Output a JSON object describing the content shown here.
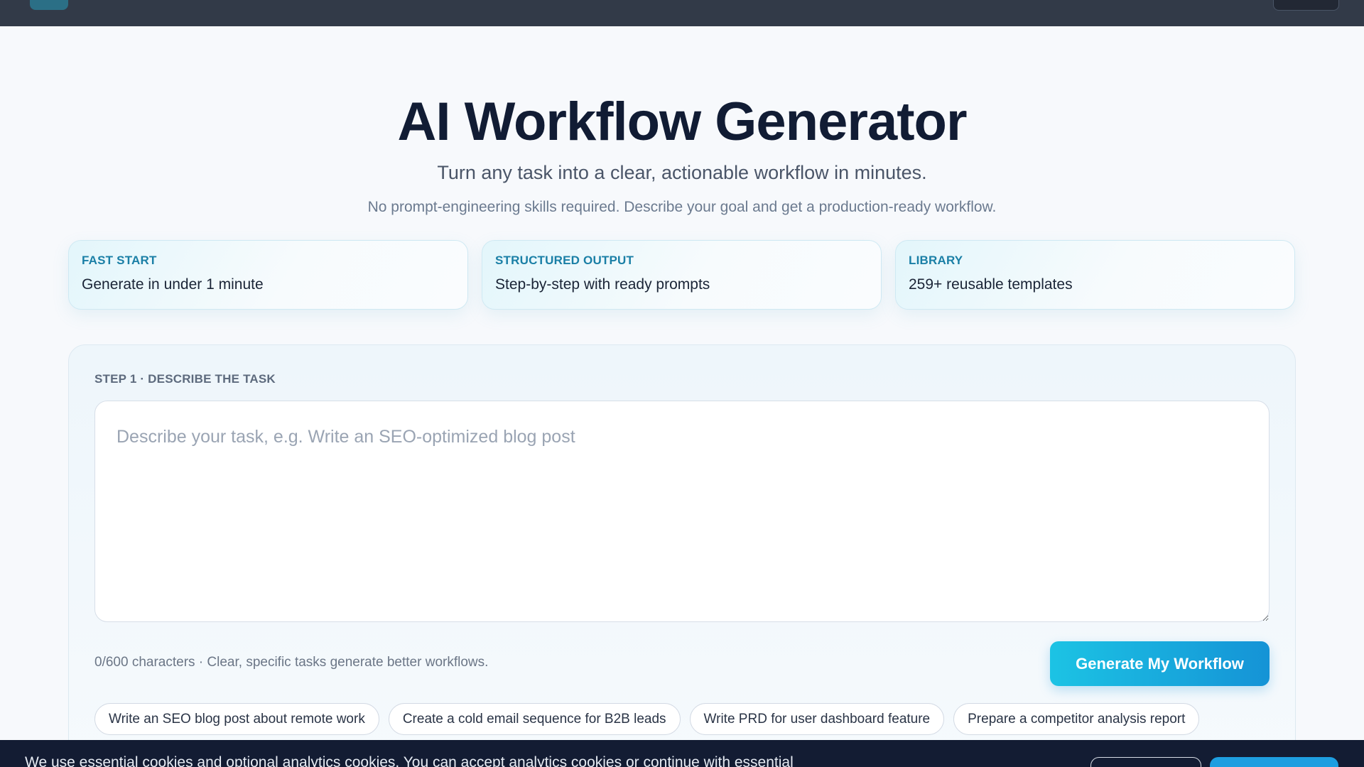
{
  "hero": {
    "title": "AI Workflow Generator",
    "subtitle": "Turn any task into a clear, actionable workflow in minutes.",
    "note": "No prompt-engineering skills required. Describe your goal and get a production-ready workflow."
  },
  "features": [
    {
      "tag": "FAST START",
      "text": "Generate in under 1 minute"
    },
    {
      "tag": "STRUCTURED OUTPUT",
      "text": "Step-by-step with ready prompts"
    },
    {
      "tag": "LIBRARY",
      "text": "259+ reusable templates"
    }
  ],
  "form": {
    "step_label": "STEP 1 · DESCRIBE THE TASK",
    "task_value": "",
    "task_placeholder": "Describe your task, e.g. Write an SEO-optimized blog post",
    "char_hint": "0/600 characters · Clear, specific tasks generate better workflows.",
    "generate_label": "Generate My Workflow"
  },
  "examples": [
    "Write an SEO blog post about remote work",
    "Create a cold email sequence for B2B leads",
    "Write PRD for user dashboard feature",
    "Prepare a competitor analysis report"
  ],
  "cookie": {
    "text": "We use essential cookies and optional analytics cookies. You can accept analytics cookies or continue with essential"
  },
  "colors": {
    "accent_start": "#1cc3e4",
    "accent_end": "#1593d6",
    "topbar": "#323a48",
    "cookie_bg": "#131c33"
  }
}
